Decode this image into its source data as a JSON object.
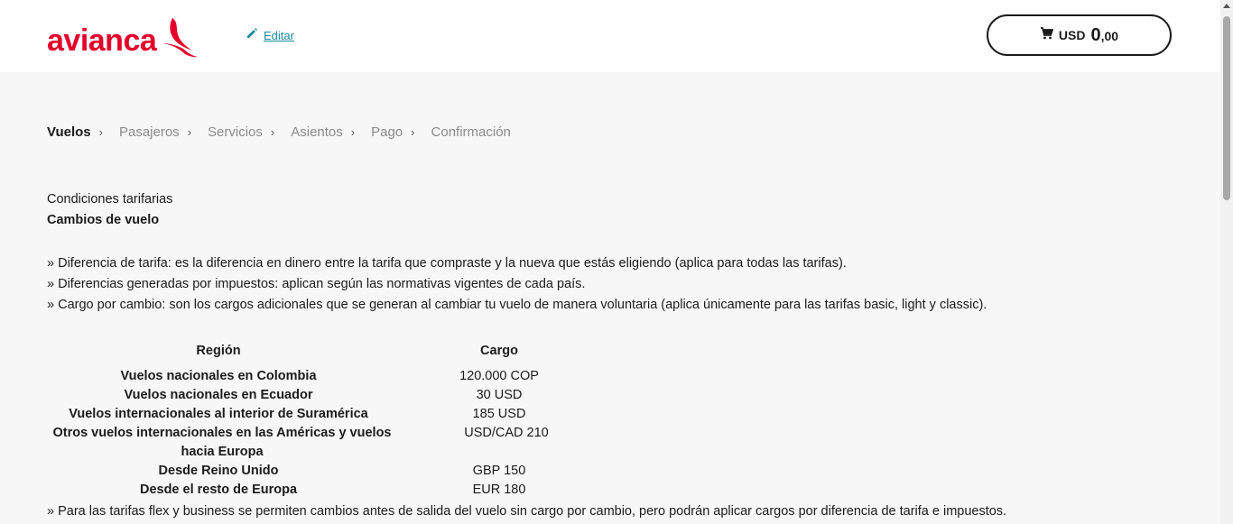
{
  "header": {
    "logo_text": "avianca",
    "edit_label": "Editar",
    "cart": {
      "currency": "USD",
      "amount_int": "0",
      "amount_dec": ",00"
    }
  },
  "steps": [
    {
      "label": "Vuelos",
      "active": true
    },
    {
      "label": "Pasajeros"
    },
    {
      "label": "Servicios"
    },
    {
      "label": "Asientos"
    },
    {
      "label": "Pago"
    },
    {
      "label": "Confirmación"
    }
  ],
  "conditions": {
    "title": "Condiciones tarifarias",
    "subtitle": "Cambios de vuelo",
    "bullets": [
      "» Diferencia de tarifa: es la diferencia en dinero entre la tarifa que compraste y la nueva que estás eligiendo (aplica para todas las tarifas).",
      "» Diferencias generadas por impuestos: aplican según las normativas vigentes de cada país.",
      "» Cargo por cambio: son los cargos adicionales que se generan al cambiar tu vuelo de manera voluntaria (aplica únicamente para las tarifas basic, light y classic)."
    ]
  },
  "fees_table": {
    "headers": {
      "region": "Región",
      "cargo": "Cargo"
    },
    "rows": [
      {
        "region": "Vuelos nacionales en Colombia",
        "cargo": "120.000 COP"
      },
      {
        "region": "Vuelos nacionales en Ecuador",
        "cargo": "30 USD"
      },
      {
        "region": "Vuelos internacionales al interior de Suramérica",
        "cargo": "185 USD"
      },
      {
        "region": "Otros vuelos internacionales en las Américas y vuelos hacia Europa",
        "cargo": "USD/CAD 210"
      },
      {
        "region": "Desde Reino Unido",
        "cargo": "GBP 150"
      },
      {
        "region": "Desde el resto de Europa",
        "cargo": "EUR 180"
      }
    ]
  },
  "note": "» Para las tarifas flex y business se permiten cambios antes de salida del vuelo sin cargo por cambio, pero podrán aplicar cargos por diferencia de tarifa e impuestos.",
  "colors": {
    "brand": "#e4002b",
    "link": "#1a8a9d",
    "background": "#f7f7f7"
  },
  "icons": [
    "avianca-bird-icon",
    "pencil-icon",
    "cart-icon",
    "chevron-right-icon"
  ]
}
